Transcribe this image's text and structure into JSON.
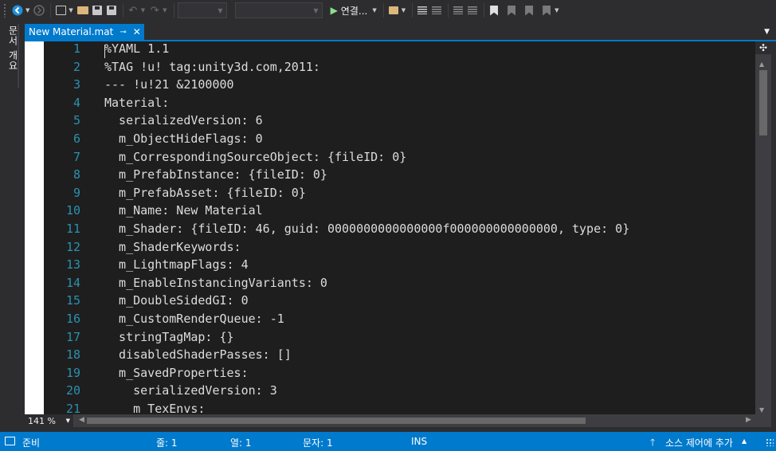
{
  "toolbar": {
    "run_label": "연결..."
  },
  "side_panel": {
    "tab_label": "문서 개요"
  },
  "document_tab": {
    "title": "New Material.mat",
    "pin_glyph": "⊸",
    "close_glyph": "✕"
  },
  "editor": {
    "lines": [
      {
        "number": "1",
        "text": "%YAML 1.1"
      },
      {
        "number": "2",
        "text": "%TAG !u! tag:unity3d.com,2011:"
      },
      {
        "number": "3",
        "text": "--- !u!21 &2100000"
      },
      {
        "number": "4",
        "text": "Material:"
      },
      {
        "number": "5",
        "text": "  serializedVersion: 6"
      },
      {
        "number": "6",
        "text": "  m_ObjectHideFlags: 0"
      },
      {
        "number": "7",
        "text": "  m_CorrespondingSourceObject: {fileID: 0}"
      },
      {
        "number": "8",
        "text": "  m_PrefabInstance: {fileID: 0}"
      },
      {
        "number": "9",
        "text": "  m_PrefabAsset: {fileID: 0}"
      },
      {
        "number": "10",
        "text": "  m_Name: New Material"
      },
      {
        "number": "11",
        "text": "  m_Shader: {fileID: 46, guid: 0000000000000000f000000000000000, type: 0}"
      },
      {
        "number": "12",
        "text": "  m_ShaderKeywords:"
      },
      {
        "number": "13",
        "text": "  m_LightmapFlags: 4"
      },
      {
        "number": "14",
        "text": "  m_EnableInstancingVariants: 0"
      },
      {
        "number": "15",
        "text": "  m_DoubleSidedGI: 0"
      },
      {
        "number": "16",
        "text": "  m_CustomRenderQueue: -1"
      },
      {
        "number": "17",
        "text": "  stringTagMap: {}"
      },
      {
        "number": "18",
        "text": "  disabledShaderPasses: []"
      },
      {
        "number": "19",
        "text": "  m_SavedProperties:"
      },
      {
        "number": "20",
        "text": "    serializedVersion: 3"
      },
      {
        "number": "21",
        "text": "    m_TexEnvs:"
      }
    ]
  },
  "zoom": {
    "value": "141 %"
  },
  "status_bar": {
    "ready": "준비",
    "line": "줄: 1",
    "column": "열: 1",
    "char": "문자: 1",
    "mode": "INS",
    "source_control": "소스 제어에 추가"
  },
  "colors": {
    "accent": "#007acc",
    "editor_bg": "#1e1e1e",
    "line_number": "#2b91af",
    "code_text": "#dcdcdc",
    "chrome_bg": "#2d2d30"
  },
  "icons": [
    "back-icon",
    "forward-icon",
    "new-project-icon",
    "open-file-icon",
    "save-icon",
    "save-all-icon",
    "undo-icon",
    "redo-icon",
    "start-icon",
    "find-in-files-icon",
    "indent-icon",
    "outdent-icon",
    "comment-icon",
    "uncomment-icon",
    "bookmark-icon",
    "prev-bookmark-icon",
    "next-bookmark-icon",
    "clear-bookmarks-icon",
    "split-editor-icon",
    "source-control-icon"
  ]
}
